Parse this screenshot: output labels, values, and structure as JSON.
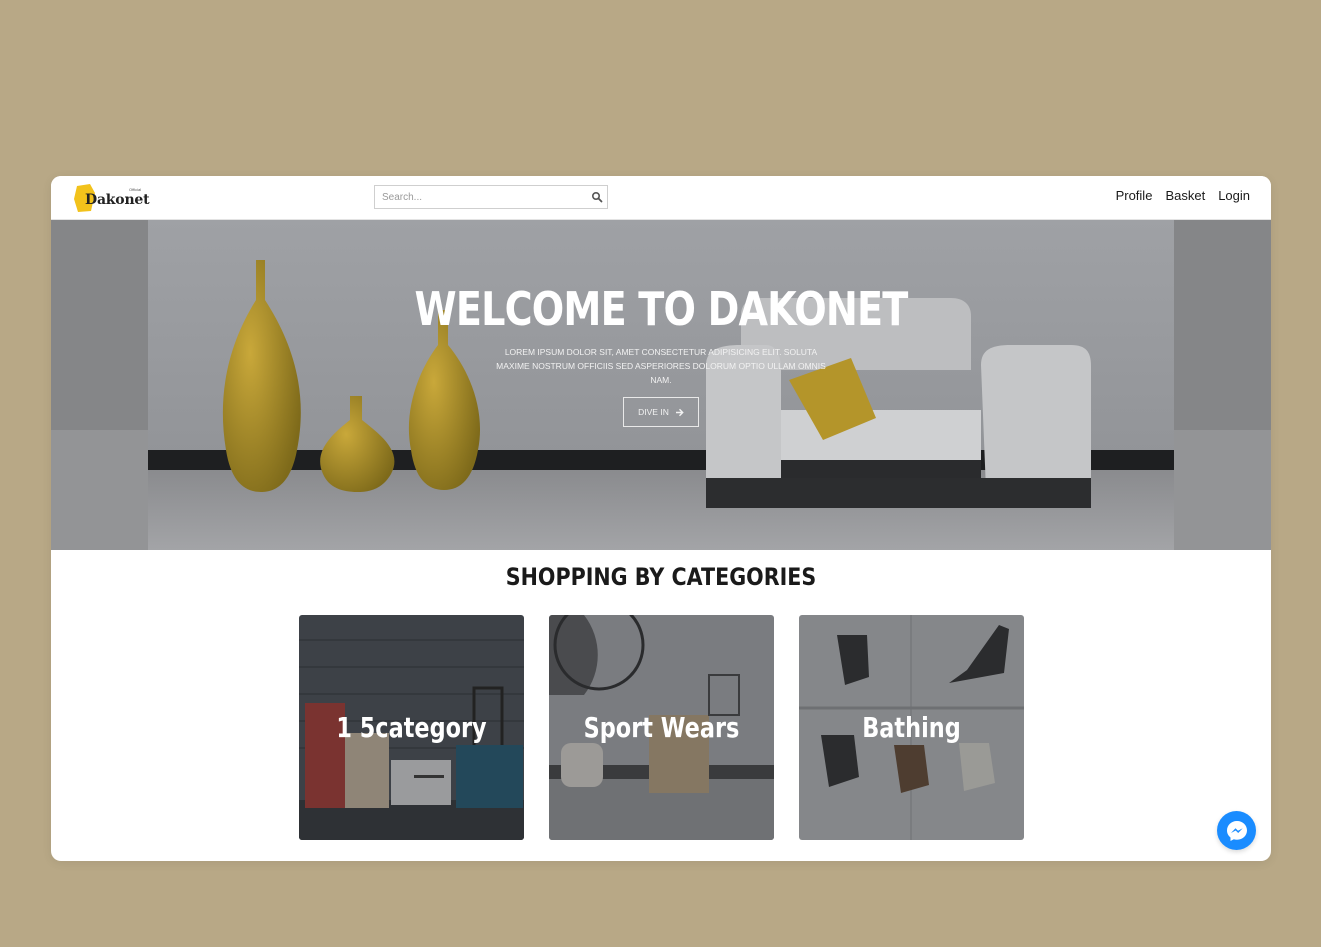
{
  "brand": {
    "name": "Dakonet",
    "tagline": "Official",
    "colors": {
      "primary": "#f2c21b",
      "page_bg": "#b8a886",
      "messenger": "#1a8cff"
    }
  },
  "search": {
    "placeholder": "Search..."
  },
  "nav": {
    "profile": "Profile",
    "basket": "Basket",
    "login": "Login"
  },
  "hero": {
    "title": "WELCOME TO DAKONET",
    "subtitle": "Lorem ipsum dolor sit, amet consectetur adipisicing elit. Soluta maxime nostrum officiis sed asperiores dolorum optio ullam omnis nam.",
    "button_label": "DIVE IN",
    "button_icon": "arrow-right-icon"
  },
  "categories": {
    "title": "SHOPPING BY CATEGORIES",
    "items": [
      {
        "label": "1 5category"
      },
      {
        "label": "Sport Wears"
      },
      {
        "label": "Bathing"
      }
    ]
  },
  "chat": {
    "icon": "messenger-icon"
  }
}
